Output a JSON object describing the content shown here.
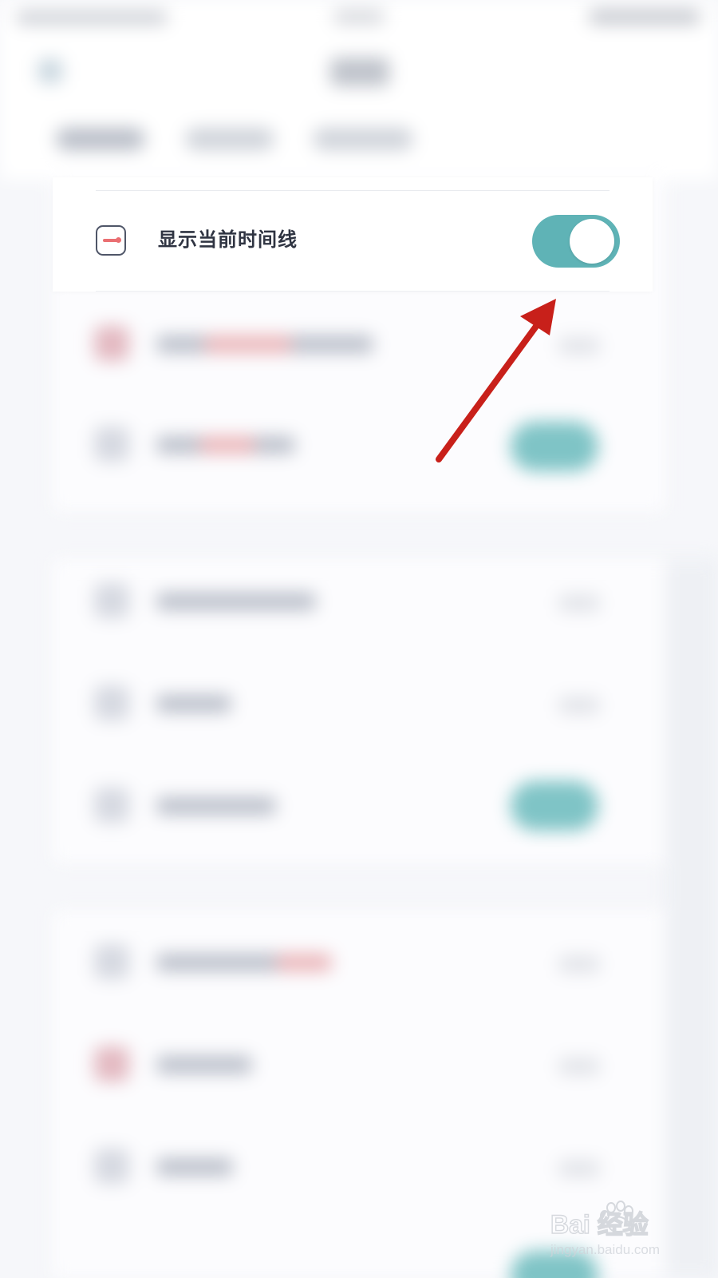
{
  "setting_row": {
    "label": "显示当前时间线",
    "enabled": true,
    "icon": "timeline-icon"
  },
  "watermark": {
    "brand": "Bai  经验",
    "url": "jingyan.baidu.com"
  },
  "colors": {
    "toggle_on": "#5fb3b6",
    "icon_accent": "#ea6f72",
    "arrow": "#c8201a"
  }
}
